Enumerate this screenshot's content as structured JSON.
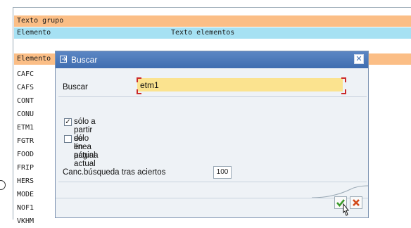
{
  "list": {
    "header_group": "Texto grupo",
    "col_element": "Elemento",
    "col_text": "Texto elementos",
    "section_element": "Elemento",
    "codes": [
      "CAFC",
      "CAFS",
      "CONT",
      "CONU",
      "ETM1",
      "FGTR",
      "FOOD",
      "FRIP",
      "HERS",
      "MODE",
      "NOF1",
      "VKHM"
    ]
  },
  "dialog": {
    "title": "Buscar",
    "search_label": "Buscar",
    "search_value": "etm1",
    "option_current_line": {
      "label": "sólo a partir de línea actual",
      "checked": true,
      "mark": "✓"
    },
    "option_current_page": {
      "label": "sólo en página actual",
      "checked": false
    },
    "cancel_after_label": "Canc.búsqueda tras aciertos",
    "cancel_after_value": "100"
  },
  "colors": {
    "orange_bar": "#fbbe86",
    "cyan_bar": "#a6e1f3",
    "title_bar": "#3f6db0",
    "input_highlight": "#fbe38f"
  },
  "icons": {
    "title": "search-dialog-icon",
    "close": "close-icon",
    "confirm": "check-icon",
    "cancel": "cancel-x-icon",
    "pointer": "mouse-pointer-icon"
  }
}
